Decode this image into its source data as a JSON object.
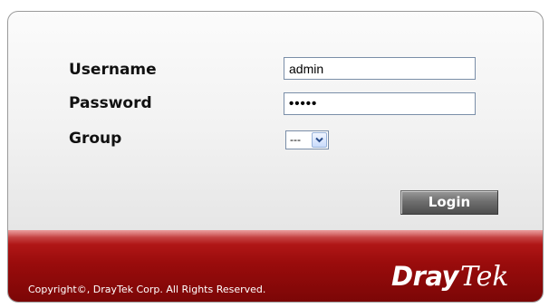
{
  "form": {
    "username_label": "Username",
    "username_value": "admin",
    "password_label": "Password",
    "password_value": "•••••",
    "group_label": "Group",
    "group_selected": "---",
    "login_label": "Login"
  },
  "footer": {
    "copyright": "Copyright©, DrayTek Corp. All Rights Reserved.",
    "logo_part1": "Dray",
    "logo_part2": "Tek"
  },
  "colors": {
    "footer_red": "#9a0c0c",
    "button_gray": "#6f6f6f",
    "input_border": "#7a8ea8"
  },
  "icons": {
    "select_arrow": "chevron-down-icon"
  }
}
